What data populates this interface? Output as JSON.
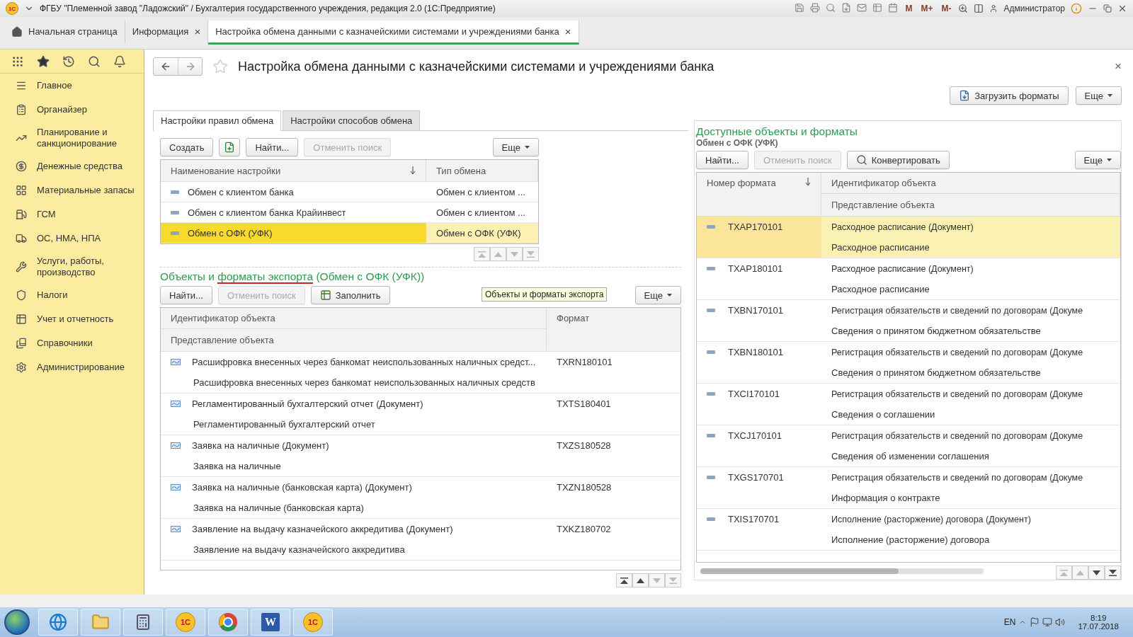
{
  "window": {
    "logo": "1С",
    "title": "ФГБУ \"Племенной завод \"Ладожский\" / Бухгалтерия государственного учреждения, редакция 2.0  (1С:Предприятие)",
    "memory_buttons": [
      "M",
      "M+",
      "M-"
    ],
    "user": "Администратор"
  },
  "open_tabs": [
    {
      "label": "Начальная страница",
      "selected": false
    },
    {
      "label": "Информация",
      "selected": false,
      "close": "×"
    },
    {
      "label": "Настройка обмена данными с казначейскими системами и учреждениями банка",
      "selected": true,
      "close": "×"
    }
  ],
  "sidebar": {
    "items": [
      {
        "label": "Главное"
      },
      {
        "label": "Органайзер"
      },
      {
        "label": "Планирование и санкционирование"
      },
      {
        "label": "Денежные средства"
      },
      {
        "label": "Материальные запасы"
      },
      {
        "label": "ГСМ"
      },
      {
        "label": "ОС, НМА, НПА"
      },
      {
        "label": "Услуги, работы, производство"
      },
      {
        "label": "Налоги"
      },
      {
        "label": "Учет и отчетность"
      },
      {
        "label": "Справочники"
      },
      {
        "label": "Администрирование"
      }
    ]
  },
  "form": {
    "title": "Настройка обмена данными с казначейскими системами и учреждениями банка",
    "close": "×",
    "buttons": [
      {
        "kind": "load",
        "label": "Загрузить форматы"
      },
      {
        "kind": "more",
        "label": "Еще"
      }
    ]
  },
  "tabs": [
    {
      "label": "Настройки правил обмена",
      "selected": true
    },
    {
      "label": "Настройки способов обмена",
      "selected": false
    }
  ],
  "settings": {
    "buttons": [
      {
        "kind": "text",
        "label": "Создать",
        "disabled": false
      },
      {
        "kind": "copy",
        "disabled": false
      },
      {
        "kind": "text",
        "label": "Найти...",
        "disabled": false
      },
      {
        "kind": "text",
        "label": "Отменить поиск",
        "disabled": true
      },
      {
        "kind": "more",
        "label": "Еще",
        "disabled": false
      }
    ],
    "columns": [
      "Наименование настройки",
      "Тип обмена"
    ],
    "rows": [
      {
        "name": "Обмен с клиентом банка",
        "type": "Обмен с клиентом ...",
        "selected": false
      },
      {
        "name": "Обмен с клиентом банка Крайинвест",
        "type": "Обмен с клиентом ...",
        "selected": false
      },
      {
        "name": "Обмен с ОФК (УФК)",
        "type": "Обмен с ОФК (УФК)",
        "selected": true
      }
    ],
    "navigation": [
      {
        "kind": "first",
        "disabled": true
      },
      {
        "kind": "up",
        "disabled": true
      },
      {
        "kind": "down",
        "disabled": true
      },
      {
        "kind": "last",
        "disabled": true
      }
    ]
  },
  "export": {
    "title_parts": [
      {
        "text": "Объекты и ",
        "marked": false
      },
      {
        "text": "форматы экспорта",
        "marked": true
      },
      {
        "text": " (Обмен с ОФК (УФК))",
        "marked": false
      }
    ],
    "tooltip": "Объекты и форматы экспорта",
    "buttons": [
      {
        "kind": "text",
        "label": "Найти...",
        "disabled": false
      },
      {
        "kind": "text",
        "label": "Отменить поиск",
        "disabled": true
      },
      {
        "kind": "fill",
        "label": "Заполнить",
        "disabled": false
      },
      {
        "kind": "more",
        "label": "Еще",
        "disabled": false
      }
    ],
    "columns": [
      "Идентификатор объекта",
      "Представление объекта",
      "Формат"
    ],
    "rows": [
      {
        "id": "Расшифровка внесенных через банкомат неиспользованных наличных средст...",
        "presentation": "Расшифровка внесенных через банкомат неиспользованных наличных средств",
        "format": "TXRN180101"
      },
      {
        "id": "Регламентированный бухгалтерский отчет (Документ)",
        "presentation": "Регламентированный бухгалтерский отчет",
        "format": "TXTS180401"
      },
      {
        "id": "Заявка на наличные (Документ)",
        "presentation": "Заявка на наличные",
        "format": "TXZS180528"
      },
      {
        "id": "Заявка на наличные (банковская карта) (Документ)",
        "presentation": "Заявка на наличные (банковская карта)",
        "format": "TXZN180528"
      },
      {
        "id": "Заявление на выдачу казначейского аккредитива (Документ)",
        "presentation": "Заявление на выдачу казначейского аккредитива",
        "format": "TXKZ180702"
      }
    ],
    "navigation": [
      {
        "kind": "first",
        "disabled": false
      },
      {
        "kind": "up",
        "disabled": false
      },
      {
        "kind": "down",
        "disabled": true
      },
      {
        "kind": "last",
        "disabled": true
      }
    ]
  },
  "available": {
    "title": "Доступные объекты и форматы",
    "subtitle": "Обмен с ОФК (УФК)",
    "buttons": [
      {
        "kind": "text",
        "label": "Найти...",
        "disabled": false
      },
      {
        "kind": "text",
        "label": "Отменить поиск",
        "disabled": true
      },
      {
        "kind": "convert",
        "label": "Конвертировать",
        "disabled": false
      },
      {
        "kind": "more",
        "label": "Еще",
        "disabled": false
      }
    ],
    "columns": [
      "Номер формата",
      "Идентификатор объекта",
      "Представление объекта"
    ],
    "rows": [
      {
        "format": "TXAP170101",
        "id": "Расходное расписание (Документ)",
        "presentation": "Расходное расписание",
        "selected": true
      },
      {
        "format": "TXAP180101",
        "id": "Расходное расписание (Документ)",
        "presentation": "Расходное расписание",
        "selected": false
      },
      {
        "format": "TXBN170101",
        "id": "Регистрация обязательств и сведений по договорам (Докуме",
        "presentation": "Сведения о принятом бюджетном обязательстве",
        "selected": false
      },
      {
        "format": "TXBN180101",
        "id": "Регистрация обязательств и сведений по договорам (Докуме",
        "presentation": "Сведения о принятом бюджетном обязательстве",
        "selected": false
      },
      {
        "format": "TXCI170101",
        "id": "Регистрация обязательств и сведений по договорам (Докуме",
        "presentation": "Сведения о соглашении",
        "selected": false
      },
      {
        "format": "TXCJ170101",
        "id": "Регистрация обязательств и сведений по договорам (Докуме",
        "presentation": "Сведения об изменении соглашения",
        "selected": false
      },
      {
        "format": "TXGS170701",
        "id": "Регистрация обязательств и сведений по договорам (Докуме",
        "presentation": "Информация о контракте",
        "selected": false
      },
      {
        "format": "TXIS170701",
        "id": "Исполнение (расторжение) договора (Документ)",
        "presentation": "Исполнение (расторжение) договора",
        "selected": false
      }
    ],
    "navigation": [
      {
        "kind": "first",
        "disabled": true
      },
      {
        "kind": "up",
        "disabled": true
      },
      {
        "kind": "down",
        "disabled": false
      },
      {
        "kind": "last",
        "disabled": false
      }
    ]
  },
  "taskbar": {
    "apps": [
      {
        "kind": "browser"
      },
      {
        "kind": "folder"
      },
      {
        "kind": "calculator"
      },
      {
        "kind": "logo",
        "label": "1С"
      },
      {
        "kind": "ball"
      },
      {
        "kind": "document",
        "label": "W"
      },
      {
        "kind": "logo",
        "label": "1С"
      }
    ],
    "language": "EN",
    "time": "8:19",
    "date": "17.07.2018"
  }
}
